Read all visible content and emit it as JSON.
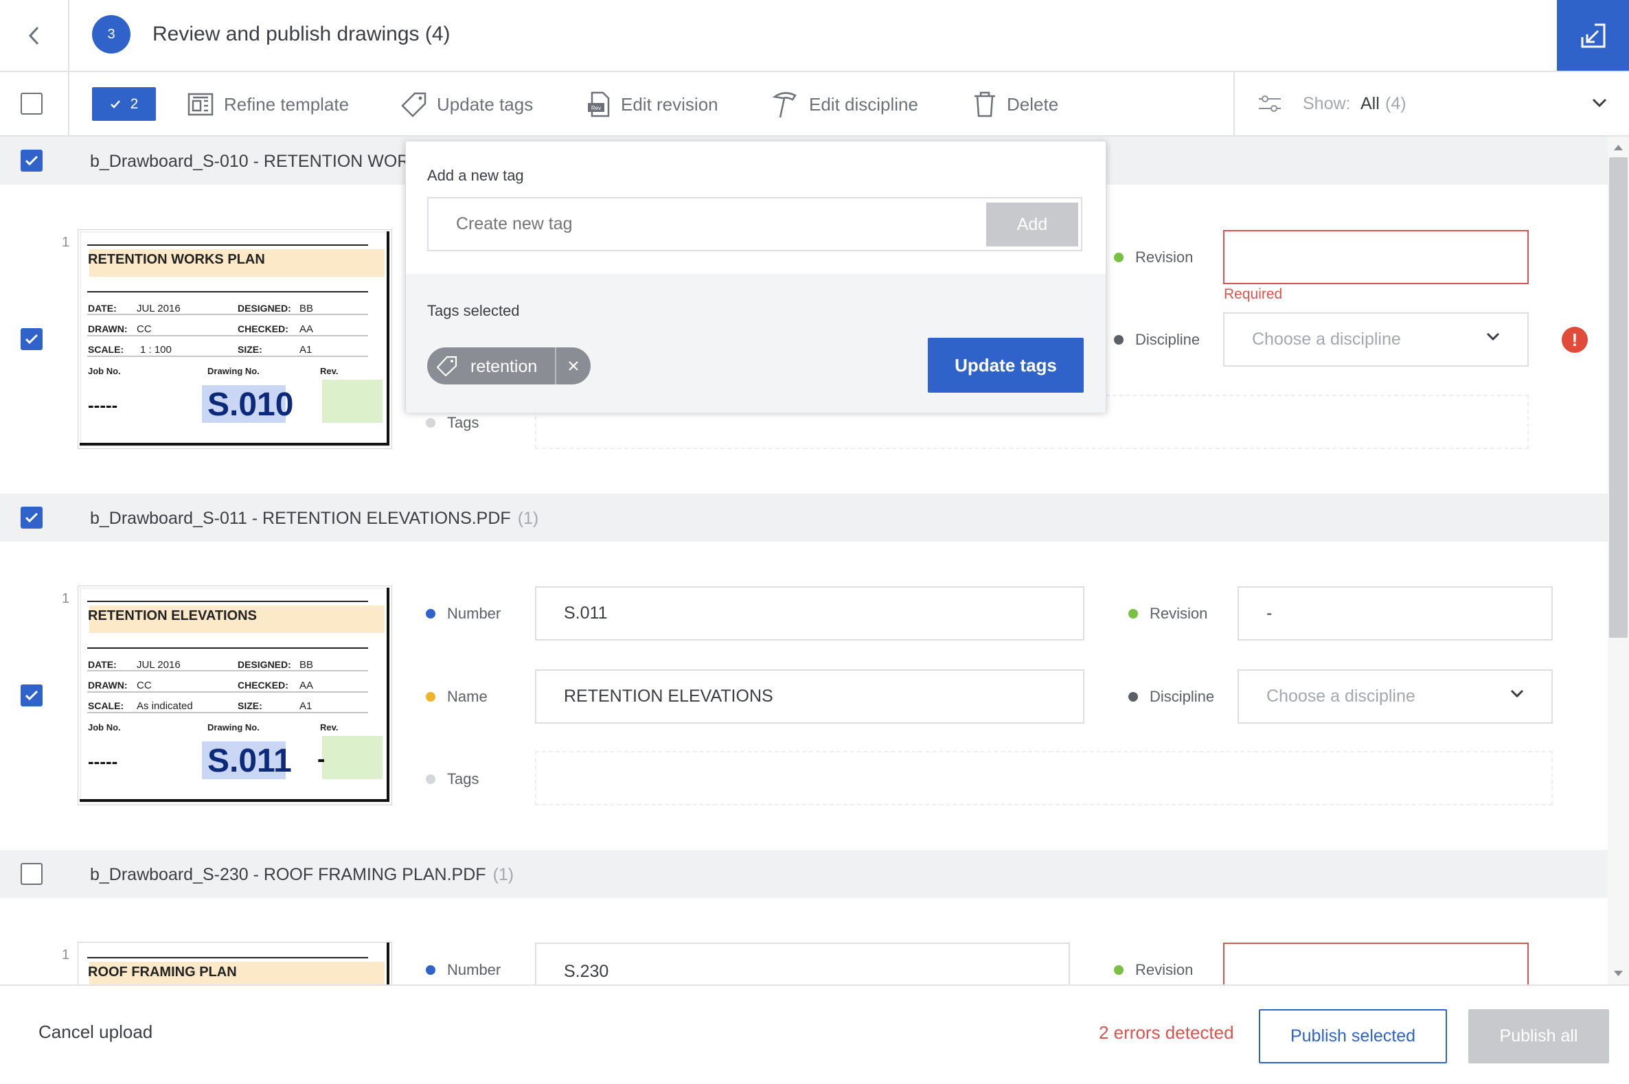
{
  "header": {
    "step": "3",
    "title": "Review and publish drawings (4)"
  },
  "toolbar": {
    "selected_count": "2",
    "refine_template": "Refine template",
    "update_tags": "Update tags",
    "edit_revision": "Edit revision",
    "edit_discipline": "Edit discipline",
    "delete": "Delete",
    "show_label": "Show:",
    "show_value": "All",
    "show_count": "(4)"
  },
  "popover": {
    "add_title": "Add a new tag",
    "input_placeholder": "Create new tag",
    "add_button": "Add",
    "selected_title": "Tags selected",
    "tag": "retention",
    "update_button": "Update tags"
  },
  "labels": {
    "number": "Number",
    "name": "Name",
    "revision": "Revision",
    "discipline": "Discipline",
    "tags": "Tags",
    "required": "Required",
    "discipline_placeholder": "Choose a discipline"
  },
  "files": [
    {
      "name": "b_Drawboard_S-010 - RETENTION WOR",
      "page": "1",
      "thumb": {
        "title": "RETENTION WORKS PLAN",
        "date": "JUL 2016",
        "designed": "BB",
        "drawn": "CC",
        "checked": "AA",
        "scale": "1 : 100",
        "size": "A1",
        "job": "-----",
        "drawing_no": "S.010",
        "rev": ""
      }
    },
    {
      "name": "b_Drawboard_S-011 - RETENTION ELEVATIONS.PDF",
      "count": "(1)",
      "page": "1",
      "number": "S.011",
      "fname": "RETENTION ELEVATIONS",
      "revision": "-",
      "thumb": {
        "title": "RETENTION ELEVATIONS",
        "date": "JUL 2016",
        "designed": "BB",
        "drawn": "CC",
        "checked": "AA",
        "scale": "As indicated",
        "size": "A1",
        "job": "-----",
        "drawing_no": "S.011",
        "rev": "-"
      }
    },
    {
      "name": "b_Drawboard_S-230 - ROOF FRAMING PLAN.PDF",
      "count": "(1)",
      "page": "1",
      "number": "S.230",
      "thumb": {
        "title": "ROOF FRAMING PLAN"
      }
    }
  ],
  "thumb_labels": {
    "date": "DATE:",
    "designed": "DESIGNED:",
    "drawn": "DRAWN:",
    "checked": "CHECKED:",
    "scale": "SCALE:",
    "size": "SIZE:",
    "job": "Job No.",
    "drawing_no": "Drawing No.",
    "rev": "Rev."
  },
  "footer": {
    "cancel": "Cancel upload",
    "errors": "2 errors detected",
    "publish_selected": "Publish selected",
    "publish_all": "Publish all"
  },
  "colors": {
    "accent": "#2f63c9",
    "error": "#d9534f",
    "dot_number": "#2f63c9",
    "dot_name": "#f0b429",
    "dot_revision": "#7bc043",
    "dot_discipline": "#5c5f66",
    "dot_tags": "#d4d6da"
  }
}
